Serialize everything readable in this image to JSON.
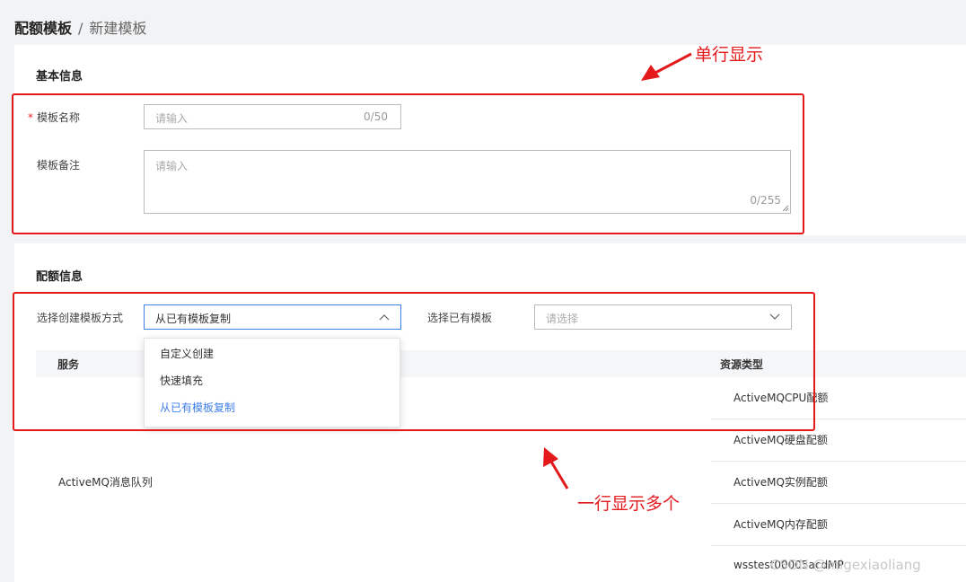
{
  "breadcrumb": {
    "parent": "配额模板",
    "separator": "/",
    "current": "新建模板"
  },
  "basic": {
    "title": "基本信息",
    "name_label": "模板名称",
    "name_required": "*",
    "name_placeholder": "请输入",
    "name_count": "0/50",
    "remark_label": "模板备注",
    "remark_placeholder": "请输入",
    "remark_count": "0/255"
  },
  "quota": {
    "title": "配额信息",
    "method_label": "选择创建模板方式",
    "method_value": "从已有模板复制",
    "existing_label": "选择已有模板",
    "existing_placeholder": "请选择",
    "options": [
      "自定义创建",
      "快速填充",
      "从已有模板复制"
    ],
    "selected_option": "从已有模板复制"
  },
  "table": {
    "headers": {
      "service": "服务",
      "resource": "资源类型"
    },
    "service_cell": "ActiveMQ消息队列",
    "resources": [
      "ActiveMQCPU配额",
      "ActiveMQ硬盘配额",
      "ActiveMQ实例配额",
      "ActiveMQ内存配额",
      "wsstest00005acdMP"
    ]
  },
  "annotations": {
    "single_row": "单行显示",
    "multi_row": "一行显示多个"
  },
  "watermark": "CSDN @migexiaoliang",
  "colors": {
    "annotation": "#e3191c",
    "selected": "#3f7fe8",
    "required": "#f5222d"
  }
}
